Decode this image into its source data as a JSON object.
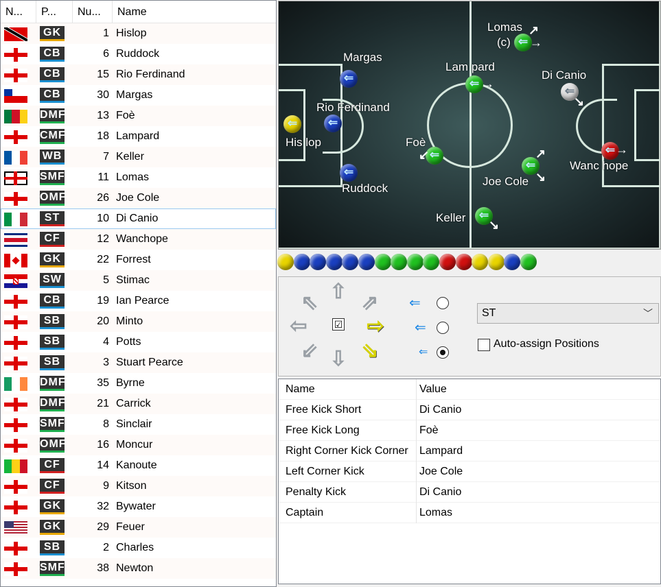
{
  "table": {
    "headers": [
      "N...",
      "P...",
      "Nu...",
      "Name"
    ],
    "rows": [
      {
        "flag": "trinidad",
        "pos": "GK",
        "num": "1",
        "name": "Hislop"
      },
      {
        "flag": "england",
        "pos": "CB",
        "num": "6",
        "name": "Ruddock"
      },
      {
        "flag": "england",
        "pos": "CB",
        "num": "15",
        "name": "Rio Ferdinand"
      },
      {
        "flag": "chile",
        "pos": "CB",
        "num": "30",
        "name": "Margas"
      },
      {
        "flag": "cameroon",
        "pos": "DMF",
        "num": "13",
        "name": "Foè"
      },
      {
        "flag": "england",
        "pos": "CMF",
        "num": "18",
        "name": "Lampard"
      },
      {
        "flag": "france",
        "pos": "WB",
        "num": "7",
        "name": "Keller"
      },
      {
        "flag": "northernireland",
        "pos": "SMF",
        "num": "11",
        "name": "Lomas"
      },
      {
        "flag": "england",
        "pos": "OMF",
        "num": "26",
        "name": "Joe Cole"
      },
      {
        "flag": "italy",
        "pos": "ST",
        "num": "10",
        "name": "Di Canio"
      },
      {
        "flag": "costarica",
        "pos": "CF",
        "num": "12",
        "name": "Wanchope"
      },
      {
        "flag": "canada",
        "pos": "GK",
        "num": "22",
        "name": "Forrest"
      },
      {
        "flag": "croatia",
        "pos": "SW",
        "num": "5",
        "name": "Stimac"
      },
      {
        "flag": "england",
        "pos": "CB",
        "num": "19",
        "name": "Ian Pearce"
      },
      {
        "flag": "england",
        "pos": "SB",
        "num": "20",
        "name": "Minto"
      },
      {
        "flag": "england",
        "pos": "SB",
        "num": "4",
        "name": "Potts"
      },
      {
        "flag": "england",
        "pos": "SB",
        "num": "3",
        "name": "Stuart Pearce"
      },
      {
        "flag": "ireland",
        "pos": "DMF",
        "num": "35",
        "name": "Byrne"
      },
      {
        "flag": "england",
        "pos": "DMF",
        "num": "21",
        "name": "Carrick"
      },
      {
        "flag": "england",
        "pos": "SMF",
        "num": "8",
        "name": "Sinclair"
      },
      {
        "flag": "england",
        "pos": "OMF",
        "num": "16",
        "name": "Moncur"
      },
      {
        "flag": "mali",
        "pos": "CF",
        "num": "14",
        "name": "Kanoute"
      },
      {
        "flag": "england",
        "pos": "CF",
        "num": "9",
        "name": "Kitson"
      },
      {
        "flag": "england",
        "pos": "GK",
        "num": "32",
        "name": "Bywater"
      },
      {
        "flag": "usa",
        "pos": "GK",
        "num": "29",
        "name": "Feuer"
      },
      {
        "flag": "england",
        "pos": "SB",
        "num": "2",
        "name": "Charles"
      },
      {
        "flag": "england",
        "pos": "SMF",
        "num": "38",
        "name": "Newton"
      }
    ],
    "selected_index": 9
  },
  "pitch": {
    "labels": {
      "lomas": "Lomas",
      "captain_mark": "(c)",
      "margas": "Margas",
      "lampard": "Lam pard",
      "di_canio": "Di Canio",
      "rio": "Rio Ferdinand",
      "hislop": "His lop",
      "foe": "Foè",
      "ruddock": "Ruddock",
      "joe_cole": "Joe Cole",
      "wanchope": "Wanc hope",
      "keller": "Keller"
    },
    "colors": {
      "gk": "#e8d400",
      "defender": "#1a3fbf",
      "midfielder": "#20c020",
      "forward": "#d01010",
      "selected": "#dcdcdc"
    }
  },
  "color_strip": [
    "#e8d400",
    "#1a3fbf",
    "#1a3fbf",
    "#1a3fbf",
    "#1a3fbf",
    "#1a3fbf",
    "#20c020",
    "#20c020",
    "#20c020",
    "#20c020",
    "#d01010",
    "#d01010",
    "#e8d400",
    "#e8d400",
    "#1a3fbf",
    "#20c020"
  ],
  "controls": {
    "position_select": "ST",
    "auto_assign_label": "Auto-assign Positions",
    "center_check": "☑",
    "run_length_selected": 2
  },
  "properties": {
    "headers": [
      "Name",
      "Value"
    ],
    "rows": [
      {
        "name": "Free Kick Short",
        "value": "Di Canio"
      },
      {
        "name": "Free Kick Long",
        "value": "Foè"
      },
      {
        "name": "Right Corner Kick Corner",
        "value": "Lampard"
      },
      {
        "name": "Left Corner Kick",
        "value": "Joe Cole"
      },
      {
        "name": "Penalty Kick",
        "value": "Di Canio"
      },
      {
        "name": "Captain",
        "value": "Lomas"
      }
    ]
  }
}
